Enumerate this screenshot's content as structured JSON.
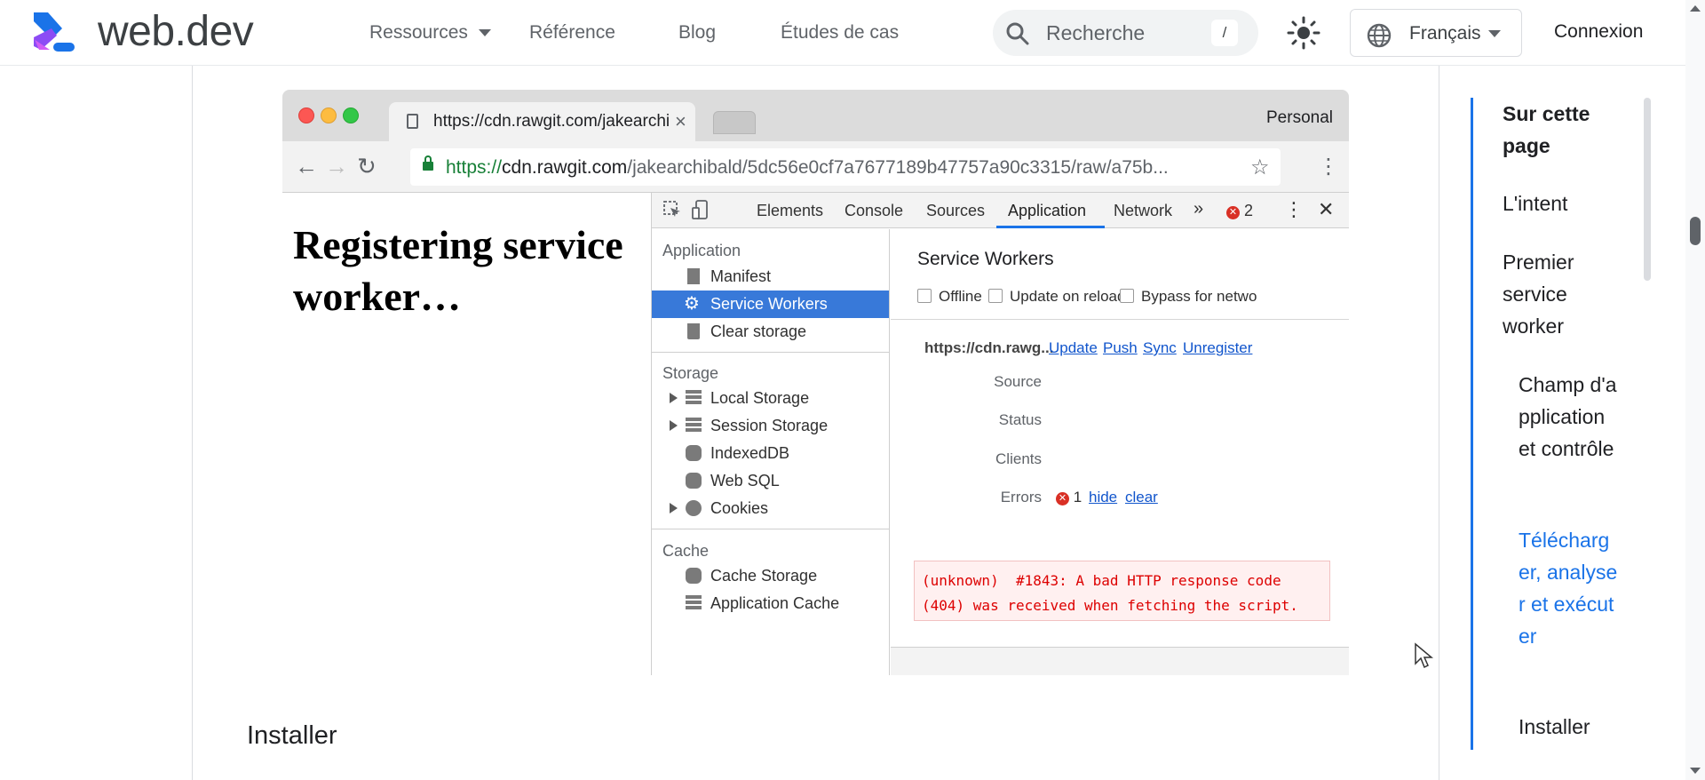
{
  "header": {
    "brand": "web.dev",
    "nav": [
      "Ressources",
      "Référence",
      "Blog",
      "Études de cas"
    ],
    "search_placeholder": "Recherche",
    "search_shortcut": "/",
    "language": "Français",
    "signin": "Connexion"
  },
  "screenshot": {
    "tab_title": "https://cdn.rawgit.com/jakearchibald",
    "profile": "Personal",
    "url_scheme": "https://",
    "url_host": "cdn.rawgit.com",
    "url_path": "/jakearchibald/5dc56e0cf7a7677189b47757a90c3315/raw/a75b...",
    "page_heading": "Registering service worker…",
    "devtools": {
      "tabs": [
        "Elements",
        "Console",
        "Sources",
        "Application",
        "Network"
      ],
      "more": "»",
      "error_count": "2",
      "sidebar": {
        "application_header": "Application",
        "application_items": [
          "Manifest",
          "Service Workers",
          "Clear storage"
        ],
        "storage_header": "Storage",
        "storage_items": [
          "Local Storage",
          "Session Storage",
          "IndexedDB",
          "Web SQL",
          "Cookies"
        ],
        "cache_header": "Cache",
        "cache_items": [
          "Cache Storage",
          "Application Cache"
        ]
      },
      "main": {
        "title": "Service Workers",
        "checkboxes": [
          "Offline",
          "Update on reload",
          "Bypass for netwo"
        ],
        "origin": "https://cdn.rawg...",
        "links": [
          "Update",
          "Push",
          "Sync",
          "Unregister"
        ],
        "labels": [
          "Source",
          "Status",
          "Clients",
          "Errors"
        ],
        "errors_count": "1",
        "errors_links": [
          "hide",
          "clear"
        ],
        "error_line1": "(unknown)  #1843: A bad HTTP response code",
        "error_line2": "(404) was received when fetching the script."
      }
    }
  },
  "section_heading": "Installer",
  "toc": {
    "title": "Sur cette page",
    "items": [
      "L'intent",
      "Premier service worker"
    ],
    "subitems": [
      "Champ d'application et contrôle",
      "Télécharger, analyser et exécuter",
      "Installer"
    ]
  },
  "colors": {
    "accent": "#1a73e8",
    "devtools_selected": "#3879d9",
    "error": "#d93025"
  }
}
